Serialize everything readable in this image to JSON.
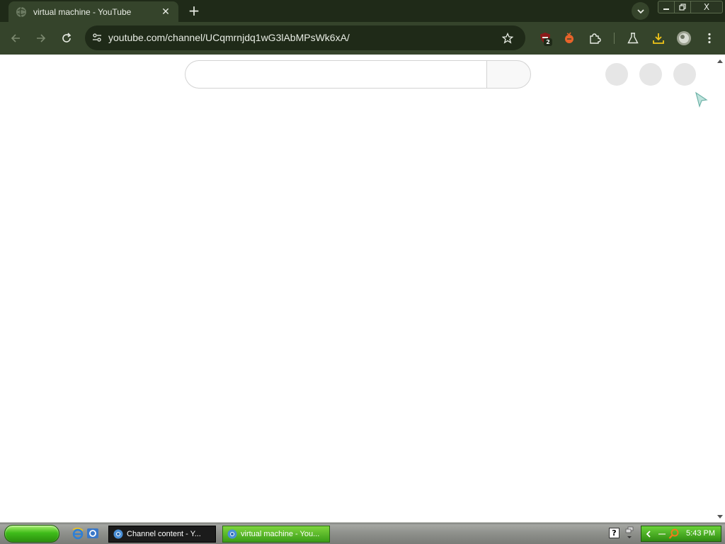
{
  "browser": {
    "tab": {
      "title": "virtual machine - YouTube",
      "close_glyph": "✕",
      "favicon": "globe-icon"
    },
    "new_tab_glyph": "+",
    "window_controls": {
      "close_glyph": "X"
    },
    "toolbar": {
      "back_icon": "arrow-left-icon",
      "forward_icon": "arrow-right-icon",
      "reload_icon": "reload-icon",
      "url": "youtube.com/channel/UCqmrnjdq1wG3lAbMPsWk6xA/",
      "extensions": [
        {
          "name": "ublock-extension-icon",
          "badge": "2"
        },
        {
          "name": "orange-extension-icon"
        },
        {
          "name": "puzzle-icon"
        },
        {
          "name": "flask-icon"
        },
        {
          "name": "download-icon"
        },
        {
          "name": "profile-avatar"
        },
        {
          "name": "menu-kebab-icon"
        }
      ]
    }
  },
  "page": {
    "search_input": {
      "value": ""
    },
    "skeleton_count": 3
  },
  "taskbar": {
    "tasks": [
      {
        "label": "Channel content - Y...",
        "active": false
      },
      {
        "label": "virtual machine - You...",
        "active": true
      }
    ],
    "help_glyph": "?",
    "clock": "5:43 PM"
  },
  "colors": {
    "chrome_dark": "#1f2a18",
    "chrome_tab": "#35442b",
    "taskbar_green": "#3fbc1a"
  }
}
